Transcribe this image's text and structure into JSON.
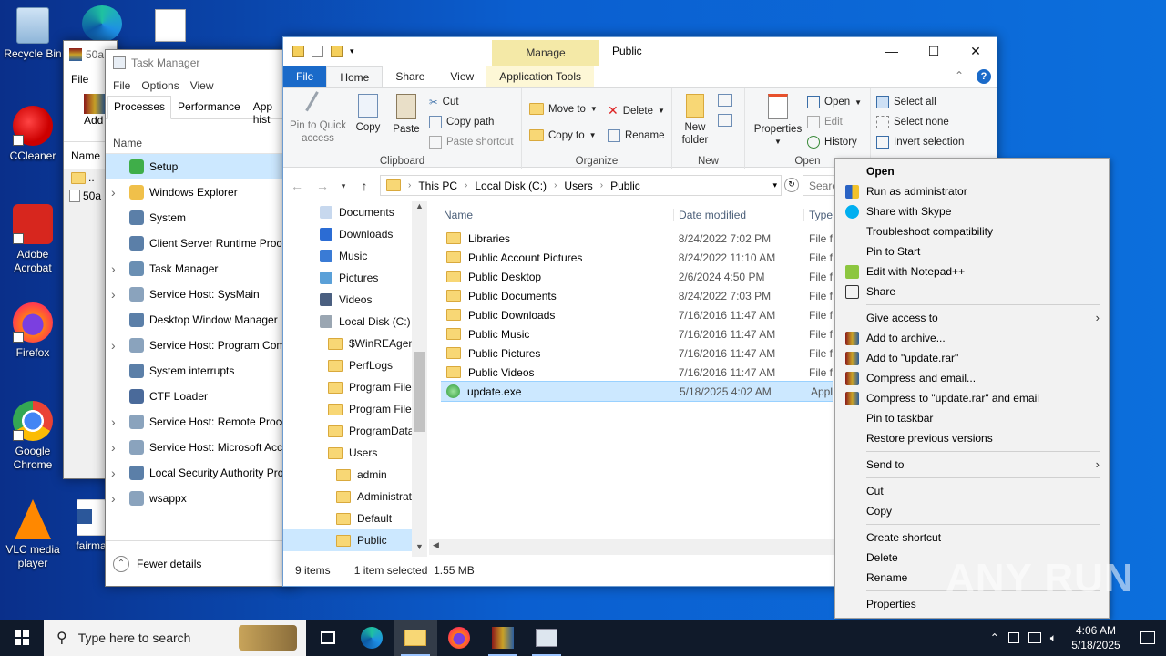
{
  "desktop": {
    "icons": [
      {
        "label": "Recycle Bin"
      },
      {
        "label": "CCleaner"
      },
      {
        "label": "Adobe Acrobat"
      },
      {
        "label": "Firefox"
      },
      {
        "label": "Google Chrome"
      },
      {
        "label": "VLC media player"
      },
      {
        "label": "fairma"
      }
    ]
  },
  "winrar": {
    "title": "50a",
    "menu_file": "File",
    "add_label": "Add",
    "col_name": "Name",
    "row_up": "..",
    "row_item": "50a"
  },
  "taskmgr": {
    "title": "Task Manager",
    "menu": [
      "File",
      "Options",
      "View"
    ],
    "tabs": [
      "Processes",
      "Performance",
      "App hist"
    ],
    "col_name": "Name",
    "processes": [
      {
        "name": "Setup",
        "expand": false,
        "selected": true
      },
      {
        "name": "Windows Explorer",
        "expand": true
      },
      {
        "name": "System",
        "expand": false
      },
      {
        "name": "Client Server Runtime Proce",
        "expand": false
      },
      {
        "name": "Task Manager",
        "expand": true
      },
      {
        "name": "Service Host: SysMain",
        "expand": true
      },
      {
        "name": "Desktop Window Manager",
        "expand": false
      },
      {
        "name": "Service Host: Program Com",
        "expand": true
      },
      {
        "name": "System interrupts",
        "expand": false
      },
      {
        "name": "CTF Loader",
        "expand": false
      },
      {
        "name": "Service Host: Remote Proce",
        "expand": true
      },
      {
        "name": "Service Host: Microsoft Acc",
        "expand": true
      },
      {
        "name": "Local Security Authority Pro",
        "expand": true
      },
      {
        "name": "wsappx",
        "expand": true
      }
    ],
    "fewer_details": "Fewer details"
  },
  "explorer": {
    "title": "Public",
    "manage_tab": "Manage",
    "ribbon_tabs": {
      "file": "File",
      "home": "Home",
      "share": "Share",
      "view": "View",
      "app_tools": "Application Tools"
    },
    "clipboard": {
      "group": "Clipboard",
      "pin": "Pin to Quick access",
      "copy": "Copy",
      "paste": "Paste",
      "cut": "Cut",
      "copy_path": "Copy path",
      "paste_shortcut": "Paste shortcut"
    },
    "organize": {
      "group": "Organize",
      "move_to": "Move to",
      "copy_to": "Copy to",
      "delete": "Delete",
      "rename": "Rename"
    },
    "new": {
      "group": "New",
      "new_folder": "New folder"
    },
    "open": {
      "group": "Open",
      "properties": "Properties",
      "open": "Open",
      "edit": "Edit",
      "history": "History"
    },
    "select": {
      "select_all": "Select all",
      "select_none": "Select none",
      "invert": "Invert selection"
    },
    "breadcrumb": [
      "This PC",
      "Local Disk (C:)",
      "Users",
      "Public"
    ],
    "search_placeholder": "Search",
    "nav_items": [
      {
        "label": "Documents",
        "indent": 0
      },
      {
        "label": "Downloads",
        "indent": 0
      },
      {
        "label": "Music",
        "indent": 0
      },
      {
        "label": "Pictures",
        "indent": 0
      },
      {
        "label": "Videos",
        "indent": 0
      },
      {
        "label": "Local Disk (C:)",
        "indent": 0
      },
      {
        "label": "$WinREAgent",
        "indent": 1
      },
      {
        "label": "PerfLogs",
        "indent": 1
      },
      {
        "label": "Program Files",
        "indent": 1
      },
      {
        "label": "Program Files",
        "indent": 1
      },
      {
        "label": "ProgramData",
        "indent": 1
      },
      {
        "label": "Users",
        "indent": 1
      },
      {
        "label": "admin",
        "indent": 2
      },
      {
        "label": "Administrat",
        "indent": 2
      },
      {
        "label": "Default",
        "indent": 2
      },
      {
        "label": "Public",
        "indent": 2,
        "selected": true
      }
    ],
    "columns": {
      "name": "Name",
      "date": "Date modified",
      "type": "Type"
    },
    "files": [
      {
        "name": "Libraries",
        "date": "8/24/2022 7:02 PM",
        "type": "File f"
      },
      {
        "name": "Public Account Pictures",
        "date": "8/24/2022 11:10 AM",
        "type": "File f"
      },
      {
        "name": "Public Desktop",
        "date": "2/6/2024 4:50 PM",
        "type": "File f"
      },
      {
        "name": "Public Documents",
        "date": "8/24/2022 7:03 PM",
        "type": "File f"
      },
      {
        "name": "Public Downloads",
        "date": "7/16/2016 11:47 AM",
        "type": "File f"
      },
      {
        "name": "Public Music",
        "date": "7/16/2016 11:47 AM",
        "type": "File f"
      },
      {
        "name": "Public Pictures",
        "date": "7/16/2016 11:47 AM",
        "type": "File f"
      },
      {
        "name": "Public Videos",
        "date": "7/16/2016 11:47 AM",
        "type": "File f"
      },
      {
        "name": "update.exe",
        "date": "5/18/2025 4:02 AM",
        "type": "Appl",
        "selected": true
      }
    ],
    "status": {
      "count": "9 items",
      "selected": "1 item selected",
      "size": "1.55 MB"
    }
  },
  "context_menu": [
    {
      "label": "Open",
      "bold": true
    },
    {
      "label": "Run as administrator",
      "icon": "shield-icon"
    },
    {
      "label": "Share with Skype",
      "icon": "skype-icon"
    },
    {
      "label": "Troubleshoot compatibility"
    },
    {
      "label": "Pin to Start"
    },
    {
      "label": "Edit with Notepad++",
      "icon": "notepad-icon"
    },
    {
      "label": "Share",
      "icon": "share-icon"
    },
    {
      "sep": true
    },
    {
      "label": "Give access to",
      "sub": true
    },
    {
      "label": "Add to archive...",
      "icon": "winrar-icon"
    },
    {
      "label": "Add to \"update.rar\"",
      "icon": "winrar-icon"
    },
    {
      "label": "Compress and email...",
      "icon": "winrar-icon"
    },
    {
      "label": "Compress to \"update.rar\" and email",
      "icon": "winrar-icon"
    },
    {
      "label": "Pin to taskbar"
    },
    {
      "label": "Restore previous versions"
    },
    {
      "sep": true
    },
    {
      "label": "Send to",
      "sub": true
    },
    {
      "sep": true
    },
    {
      "label": "Cut"
    },
    {
      "label": "Copy"
    },
    {
      "sep": true
    },
    {
      "label": "Create shortcut"
    },
    {
      "label": "Delete"
    },
    {
      "label": "Rename"
    },
    {
      "sep": true
    },
    {
      "label": "Properties"
    }
  ],
  "watermark": "ANY RUN",
  "taskbar": {
    "search_placeholder": "Type here to search",
    "time": "4:06 AM",
    "date": "5/18/2025"
  },
  "colors": {
    "accent": "#1a6ac9",
    "selection": "#cce8ff",
    "folder": "#f8d775",
    "taskbar": "#101a2a"
  }
}
